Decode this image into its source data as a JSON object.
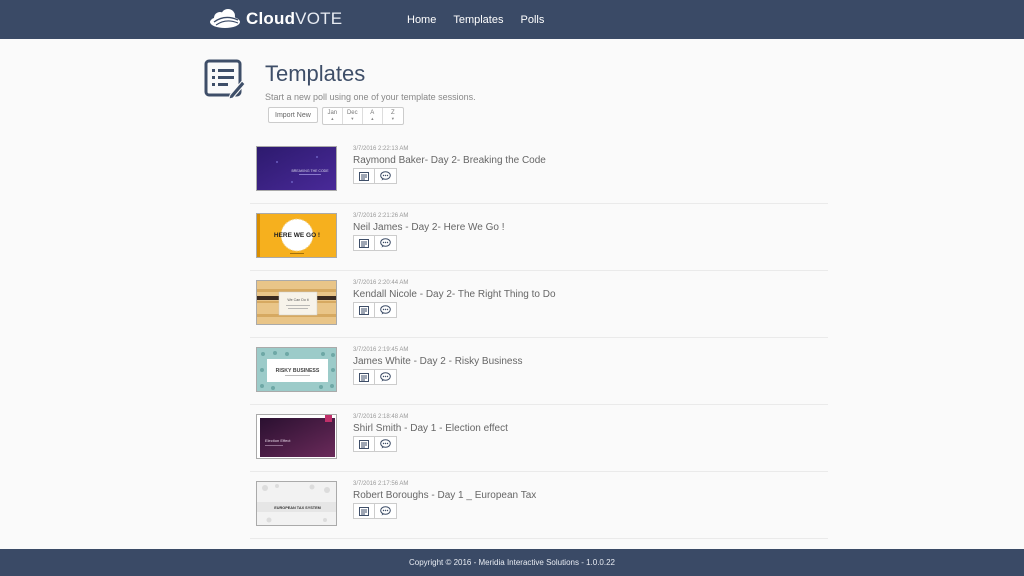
{
  "header": {
    "logo_bold": "Cloud",
    "logo_light": "VOTE",
    "nav": [
      "Home",
      "Templates",
      "Polls"
    ]
  },
  "page": {
    "title": "Templates",
    "subtitle": "Start a new poll using one of your template sessions."
  },
  "toolbar": {
    "import_label": "Import New",
    "sort": [
      {
        "label": "Jan",
        "arrow": "▲"
      },
      {
        "label": "Dec",
        "arrow": "▼"
      },
      {
        "label": "A",
        "arrow": "▲"
      },
      {
        "label": "Z",
        "arrow": "▼"
      }
    ]
  },
  "templates": [
    {
      "date": "3/7/2016 2:22:13 AM",
      "title": "Raymond Baker- Day 2- Breaking the Code",
      "thumb_text": "BREAKING THE CODE"
    },
    {
      "date": "3/7/2016 2:21:26 AM",
      "title": "Neil James - Day 2- Here We Go !",
      "thumb_text": "HERE WE GO !"
    },
    {
      "date": "3/7/2016 2:20:44 AM",
      "title": "Kendall Nicole - Day 2- The Right Thing to Do",
      "thumb_text": "We Can Do it"
    },
    {
      "date": "3/7/2016 2:19:45 AM",
      "title": "James White - Day 2 - Risky Business",
      "thumb_text": "RISKY BUSINESS"
    },
    {
      "date": "3/7/2016 2:18:48 AM",
      "title": "Shirl Smith - Day 1 - Election effect",
      "thumb_text": "Election Effect"
    },
    {
      "date": "3/7/2016 2:17:56 AM",
      "title": "Robert Boroughs - Day 1 _ European Tax",
      "thumb_text": "EUROPEAN TAX SYSTEM"
    }
  ],
  "footer": {
    "copyright": "Copyright © 2016 - Meridia Interactive Solutions - 1.0.0.22"
  },
  "colors": {
    "header_bg": "#3a4a66",
    "title": "#3e4e68",
    "page_bg": "#fafafa"
  }
}
